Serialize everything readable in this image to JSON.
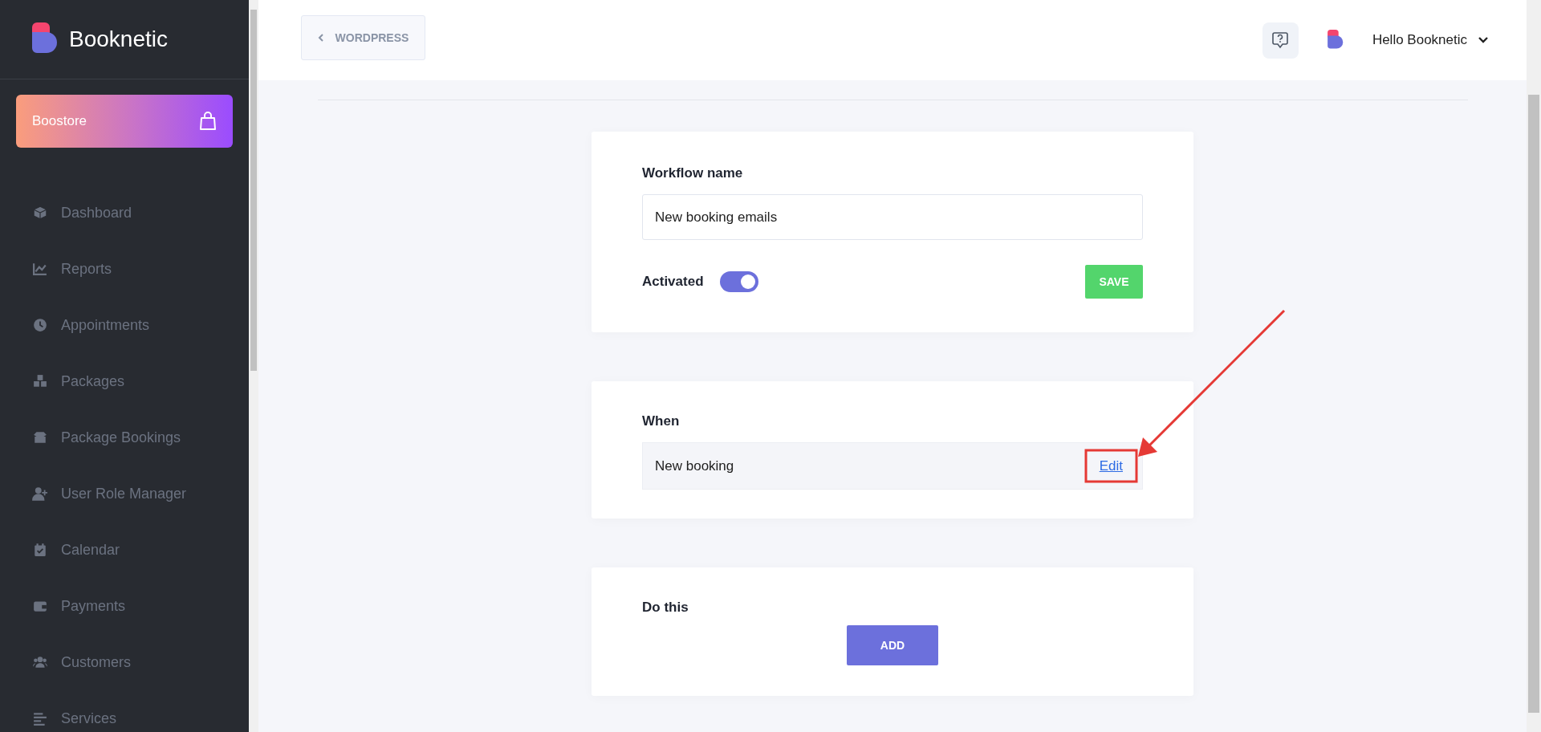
{
  "sidebar": {
    "brand": "Booknetic",
    "boostore": "Boostore",
    "items": [
      {
        "label": "Dashboard"
      },
      {
        "label": "Reports"
      },
      {
        "label": "Appointments"
      },
      {
        "label": "Packages"
      },
      {
        "label": "Package Bookings"
      },
      {
        "label": "User Role Manager"
      },
      {
        "label": "Calendar"
      },
      {
        "label": "Payments"
      },
      {
        "label": "Customers"
      },
      {
        "label": "Services"
      }
    ]
  },
  "header": {
    "back_button": "WORDPRESS",
    "user": "Hello Booknetic"
  },
  "workflow": {
    "name_label": "Workflow name",
    "name_value": "New booking emails",
    "activated_label": "Activated",
    "activated": true,
    "save": "SAVE"
  },
  "when": {
    "title": "When",
    "trigger": "New booking",
    "edit": "Edit"
  },
  "do_this": {
    "title": "Do this",
    "add": "ADD"
  }
}
